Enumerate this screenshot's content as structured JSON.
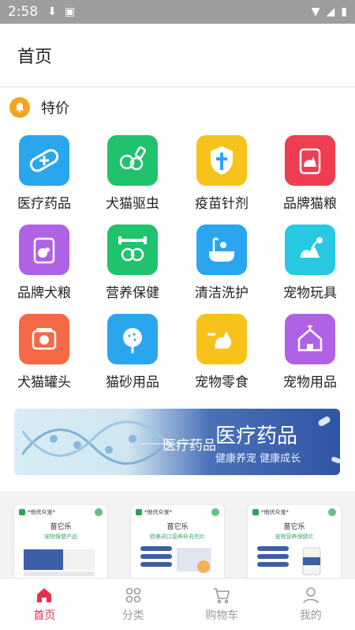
{
  "status_bar": {
    "time": "2:58"
  },
  "header": {
    "title": "首页"
  },
  "section": {
    "label": "特价"
  },
  "categories": [
    {
      "label": "医疗药品",
      "color": "#2aa6ef",
      "icon": "bandage-icon"
    },
    {
      "label": "犬猫驱虫",
      "color": "#20c36c",
      "icon": "dog-cat-spray-icon"
    },
    {
      "label": "疫苗针剂",
      "color": "#f7c21a",
      "icon": "vaccine-shield-icon"
    },
    {
      "label": "品牌猫粮",
      "color": "#ef3d52",
      "icon": "cat-food-bag-icon"
    },
    {
      "label": "品牌犬粮",
      "color": "#b062e6",
      "icon": "dog-food-bag-icon"
    },
    {
      "label": "营养保健",
      "color": "#20c36c",
      "icon": "dog-dumbbell-icon"
    },
    {
      "label": "清洁洗护",
      "color": "#2aa6ef",
      "icon": "bathtub-icon"
    },
    {
      "label": "宠物玩具",
      "color": "#28c9e0",
      "icon": "cat-toy-icon"
    },
    {
      "label": "犬猫罐头",
      "color": "#f56a46",
      "icon": "can-icon"
    },
    {
      "label": "猫砂用品",
      "color": "#2aa6ef",
      "icon": "litter-scoop-icon"
    },
    {
      "label": "宠物零食",
      "color": "#f7c21a",
      "icon": "cat-treat-icon"
    },
    {
      "label": "宠物用品",
      "color": "#b062e6",
      "icon": "pet-house-icon"
    }
  ],
  "banner": {
    "small_text": "医疗药品",
    "big_text": "医疗药品",
    "sub_text": "健康养宠 健康成长"
  },
  "products": [
    {
      "brand": "*他优众宠*",
      "name": "苗它乐",
      "desc": "宠物保健产品"
    },
    {
      "brand": "*他优众宠*",
      "name": "苗它乐",
      "desc": "欧美进口营养补充剂片"
    },
    {
      "brand": "*他优众宠*",
      "name": "苗它乐",
      "desc": "宠物营养保健片"
    }
  ],
  "bottom_nav": [
    {
      "label": "首页",
      "active": true
    },
    {
      "label": "分类",
      "active": false
    },
    {
      "label": "购物车",
      "active": false
    },
    {
      "label": "我的",
      "active": false
    }
  ],
  "colors": {
    "accent": "#e8304f",
    "bell": "#f7a31c"
  }
}
